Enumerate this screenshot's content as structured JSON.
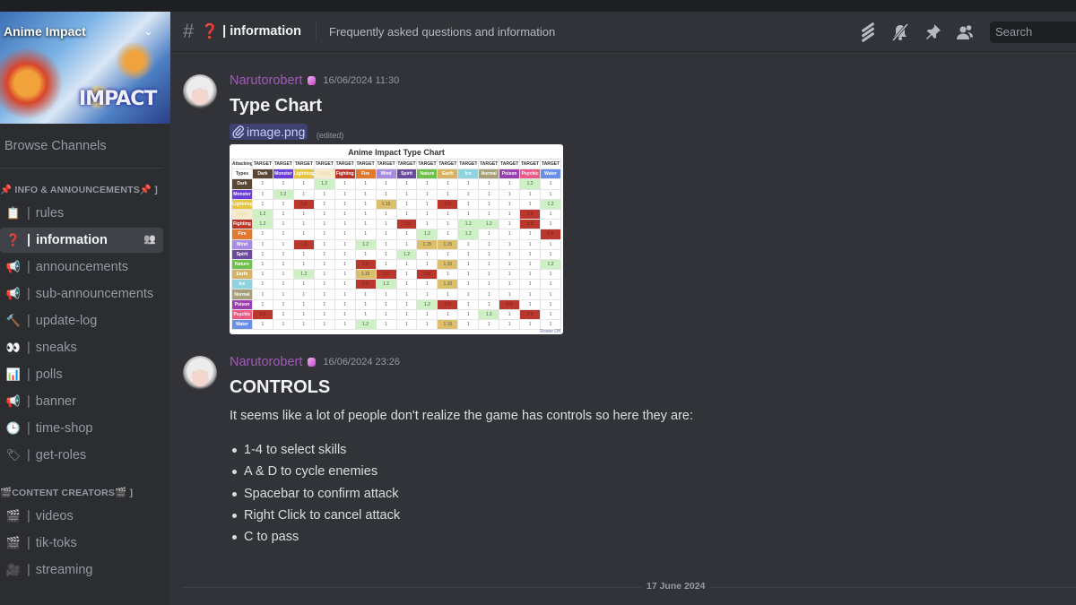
{
  "server": {
    "name": "Anime Impact",
    "banner_logo_text": "IMPACT",
    "chevron_icon": "chevron-down-icon"
  },
  "sidebar": {
    "browse_channels": "Browse Channels",
    "categories": [
      {
        "label": "📌 INFO & ANNOUNCEMENTS📌 ]",
        "channels": [
          {
            "emoji": "📋",
            "name": "rules",
            "active": false
          },
          {
            "emoji": "❓",
            "name": "information",
            "active": true
          },
          {
            "emoji": "📢",
            "name": "announcements",
            "active": false
          },
          {
            "emoji": "📢",
            "name": "sub-announcements",
            "active": false
          },
          {
            "emoji": "🔨",
            "name": "update-log",
            "active": false
          },
          {
            "emoji": "👀",
            "name": "sneaks",
            "active": false
          },
          {
            "emoji": "📊",
            "name": "polls",
            "active": false
          },
          {
            "emoji": "📢",
            "name": "banner",
            "active": false
          },
          {
            "emoji": "🕒",
            "name": "time-shop",
            "active": false
          },
          {
            "emoji": "🏷",
            "name": "get-roles",
            "active": false
          }
        ]
      },
      {
        "label": "🎬CONTENT CREATORS🎬 ]",
        "channels": [
          {
            "emoji": "🎬",
            "name": "videos",
            "active": false
          },
          {
            "emoji": "🎬",
            "name": "tik-toks",
            "active": false
          },
          {
            "emoji": "🎥",
            "name": "streaming",
            "active": false
          }
        ]
      }
    ]
  },
  "header": {
    "channel_emoji": "❓",
    "channel_name": "| information",
    "topic": "Frequently asked questions and information",
    "tools": [
      "threads-icon",
      "mute-bell-icon",
      "pin-icon",
      "member-list-icon"
    ],
    "search_placeholder": "Search"
  },
  "messages": [
    {
      "author": "Narutorobert",
      "author_color": "#a05ab8",
      "timestamp": "16/06/2024 11:30",
      "heading": "Type Chart",
      "attachment_name": "image.png",
      "edited_label": "(edited)",
      "image": {
        "title": "Anime Impact Type Chart",
        "corner_label": "Attacking →",
        "target_label": "TARGET",
        "types_label": "Types",
        "credit": "Roster Off",
        "types": [
          {
            "name": "Dark",
            "color": "#5a4634"
          },
          {
            "name": "Monster",
            "color": "#6a3fd8"
          },
          {
            "name": "Lightning",
            "color": "#e5c542"
          },
          {
            "name": "Light",
            "color": "#f6eccb"
          },
          {
            "name": "Fighting",
            "color": "#b9372c"
          },
          {
            "name": "Fire",
            "color": "#e0782f"
          },
          {
            "name": "Wind",
            "color": "#a78be3"
          },
          {
            "name": "Spirit",
            "color": "#6a4a9c"
          },
          {
            "name": "Nature",
            "color": "#6fbf4a"
          },
          {
            "name": "Earth",
            "color": "#d6b362"
          },
          {
            "name": "Ice",
            "color": "#8fd3de"
          },
          {
            "name": "Normal",
            "color": "#a5a07a"
          },
          {
            "name": "Poison",
            "color": "#9a3fb0"
          },
          {
            "name": "Psychic",
            "color": "#ea5a86"
          },
          {
            "name": "Water",
            "color": "#6b8ee8"
          }
        ],
        "cell_colors": {
          "super": "#cdf0c4",
          "strong": "#dcbf6a",
          "weak": "#b9372c"
        },
        "matrix": [
          [
            "1",
            "1",
            "1",
            "1.2",
            "1",
            "1",
            "1",
            "1",
            "1",
            "1",
            "1",
            "1",
            "1",
            "1.2",
            "1"
          ],
          [
            "1",
            "1.2",
            "1",
            "1",
            "1",
            "1",
            "1",
            "1",
            "1",
            "1",
            "1",
            "1",
            "1",
            "1",
            "1"
          ],
          [
            "1",
            "1",
            "0.8",
            "1",
            "1",
            "1",
            "1.15",
            "1",
            "1",
            "0.8",
            "1",
            "1",
            "1",
            "1",
            "1.2"
          ],
          [
            "1.2",
            "1",
            "1",
            "1",
            "1",
            "1",
            "1",
            "1",
            "1",
            "1",
            "1",
            "1",
            "1",
            "0.8",
            "1"
          ],
          [
            "1.2",
            "1",
            "1",
            "1",
            "1",
            "1",
            "1",
            "0.8",
            "1",
            "1",
            "1.2",
            "1.2",
            "1",
            "0.8",
            "1"
          ],
          [
            "1",
            "1",
            "1",
            "1",
            "1",
            "1",
            "1",
            "1",
            "1.2",
            "1",
            "1.2",
            "1",
            "1",
            "1",
            "0.8"
          ],
          [
            "1",
            "1",
            "0.8",
            "1",
            "1",
            "1.2",
            "1",
            "1",
            "1.15",
            "1.15",
            "1",
            "1",
            "1",
            "1",
            "1"
          ],
          [
            "1",
            "1",
            "1",
            "1",
            "1",
            "1",
            "1",
            "1.2",
            "1",
            "1",
            "1",
            "1",
            "1",
            "1",
            "1"
          ],
          [
            "1",
            "1",
            "1",
            "1",
            "1",
            "0.8",
            "1",
            "1",
            "1",
            "1.15",
            "1",
            "1",
            "1",
            "1",
            "1.2"
          ],
          [
            "1",
            "1",
            "1.2",
            "1",
            "1",
            "1.15",
            "0.8",
            "1",
            "0.8",
            "1",
            "1",
            "1",
            "1",
            "1",
            "1"
          ],
          [
            "1",
            "1",
            "1",
            "1",
            "1",
            "0.8",
            "1.2",
            "1",
            "1",
            "1.15",
            "1",
            "1",
            "1",
            "1",
            "1"
          ],
          [
            "1",
            "1",
            "1",
            "1",
            "1",
            "1",
            "1",
            "1",
            "1",
            "1",
            "1",
            "1",
            "1",
            "1",
            "1"
          ],
          [
            "1",
            "1",
            "1",
            "1",
            "1",
            "1",
            "1",
            "1",
            "1.2",
            "0.8",
            "1",
            "1",
            "0.8",
            "1",
            "1"
          ],
          [
            "0.8",
            "1",
            "1",
            "1",
            "1",
            "1",
            "1",
            "1",
            "1",
            "1",
            "1",
            "1.2",
            "1",
            "0.8",
            "1"
          ],
          [
            "1",
            "1",
            "1",
            "1",
            "1",
            "1.2",
            "1",
            "1",
            "1",
            "1.15",
            "1",
            "1",
            "1",
            "1",
            "1"
          ]
        ]
      }
    },
    {
      "author": "Narutorobert",
      "author_color": "#a05ab8",
      "timestamp": "16/06/2024 23:26",
      "heading": "CONTROLS",
      "body": "It seems like a lot of people don't realize the game has controls so here they are:",
      "list": [
        "1-4 to select skills",
        "A & D to cycle enemies",
        "Spacebar to confirm attack",
        "Right Click to cancel attack",
        "C to pass"
      ]
    }
  ],
  "date_divider": "17 June 2024"
}
